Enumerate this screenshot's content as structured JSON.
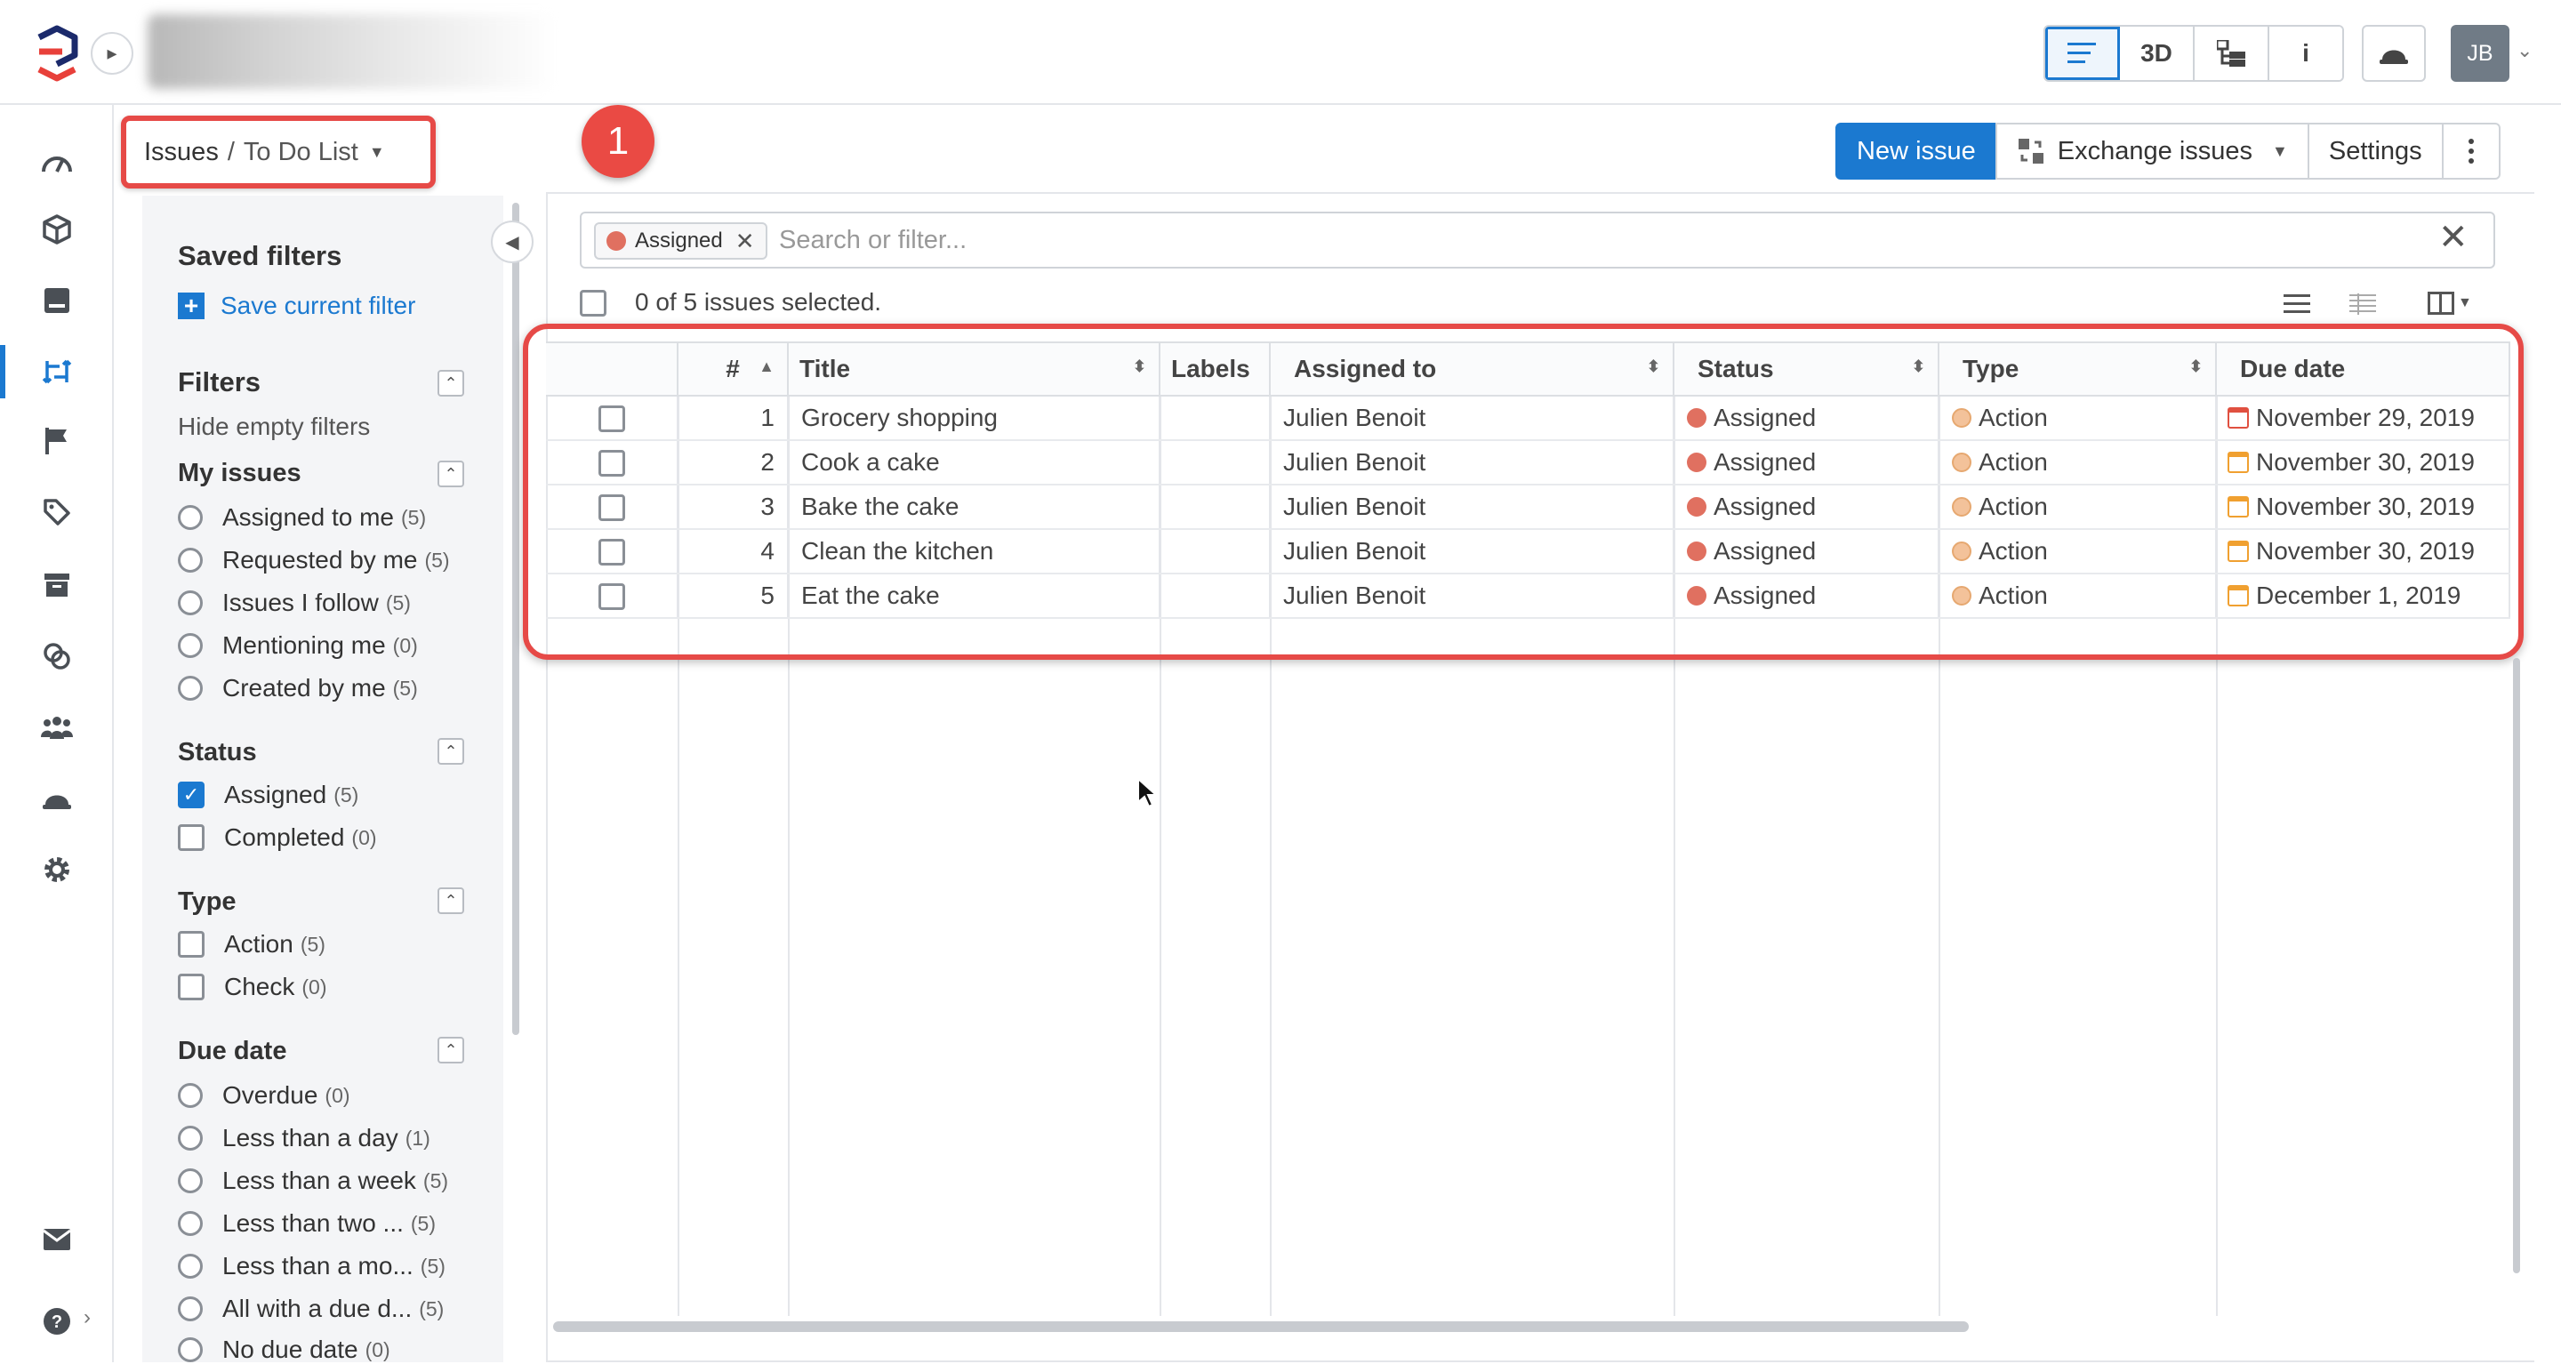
{
  "topbar": {
    "view_buttons": [
      {
        "icon": "list-icon",
        "label": "",
        "active": true
      },
      {
        "icon": "3d-view",
        "label": "3D",
        "active": false
      },
      {
        "icon": "tree-icon",
        "label": "",
        "active": false
      },
      {
        "icon": "info-icon",
        "label": "i",
        "active": false
      }
    ],
    "user_initials": "JB"
  },
  "breadcrumb": {
    "root": "Issues",
    "separator": "/",
    "current": "To Do List"
  },
  "annotation_badge": "1",
  "actions": {
    "new_issue": "New issue",
    "exchange": "Exchange issues",
    "settings": "Settings"
  },
  "filters_panel": {
    "saved_filters_title": "Saved filters",
    "save_current": "Save current filter",
    "filters_title": "Filters",
    "hide_empty": "Hide empty filters",
    "sections": [
      {
        "title": "My issues",
        "kind": "radio",
        "items": [
          {
            "label": "Assigned to me",
            "count": "(5)"
          },
          {
            "label": "Requested by me",
            "count": "(5)"
          },
          {
            "label": "Issues I follow",
            "count": "(5)"
          },
          {
            "label": "Mentioning me",
            "count": "(0)"
          },
          {
            "label": "Created by me",
            "count": "(5)"
          }
        ]
      },
      {
        "title": "Status",
        "kind": "checkbox",
        "items": [
          {
            "label": "Assigned",
            "count": "(5)",
            "checked": true
          },
          {
            "label": "Completed",
            "count": "(0)",
            "checked": false
          }
        ]
      },
      {
        "title": "Type",
        "kind": "checkbox",
        "items": [
          {
            "label": "Action",
            "count": "(5)",
            "checked": false
          },
          {
            "label": "Check",
            "count": "(0)",
            "checked": false
          }
        ]
      },
      {
        "title": "Due date",
        "kind": "radio",
        "items": [
          {
            "label": "Overdue",
            "count": "(0)"
          },
          {
            "label": "Less than a day",
            "count": "(1)"
          },
          {
            "label": "Less than a week",
            "count": "(5)"
          },
          {
            "label": "Less than two ...",
            "count": "(5)"
          },
          {
            "label": "Less than a mo...",
            "count": "(5)"
          },
          {
            "label": "All with a due d...",
            "count": "(5)"
          },
          {
            "label": "No due date",
            "count": "(0)"
          }
        ]
      }
    ]
  },
  "search": {
    "chip_label": "Assigned",
    "placeholder": "Search or filter..."
  },
  "selection_text": "0 of 5 issues selected.",
  "table": {
    "columns": [
      "#",
      "Title",
      "Labels",
      "Assigned to",
      "Status",
      "Type",
      "Due date"
    ],
    "rows": [
      {
        "num": "1",
        "title": "Grocery shopping",
        "labels": "",
        "assigned": "Julien Benoit",
        "status": "Assigned",
        "type": "Action",
        "due": "November 29, 2019",
        "due_icon": "red"
      },
      {
        "num": "2",
        "title": "Cook a cake",
        "labels": "",
        "assigned": "Julien Benoit",
        "status": "Assigned",
        "type": "Action",
        "due": "November 30, 2019",
        "due_icon": "orange"
      },
      {
        "num": "3",
        "title": "Bake the cake",
        "labels": "",
        "assigned": "Julien Benoit",
        "status": "Assigned",
        "type": "Action",
        "due": "November 30, 2019",
        "due_icon": "orange"
      },
      {
        "num": "4",
        "title": "Clean the kitchen",
        "labels": "",
        "assigned": "Julien Benoit",
        "status": "Assigned",
        "type": "Action",
        "due": "November 30, 2019",
        "due_icon": "orange"
      },
      {
        "num": "5",
        "title": "Eat the cake",
        "labels": "",
        "assigned": "Julien Benoit",
        "status": "Assigned",
        "type": "Action",
        "due": "December 1, 2019",
        "due_icon": "orange"
      }
    ]
  },
  "colors": {
    "accent": "#1b79d0",
    "highlight": "#e64a47",
    "status_assigned": "#e07060",
    "type_action": "#f3c29a"
  }
}
